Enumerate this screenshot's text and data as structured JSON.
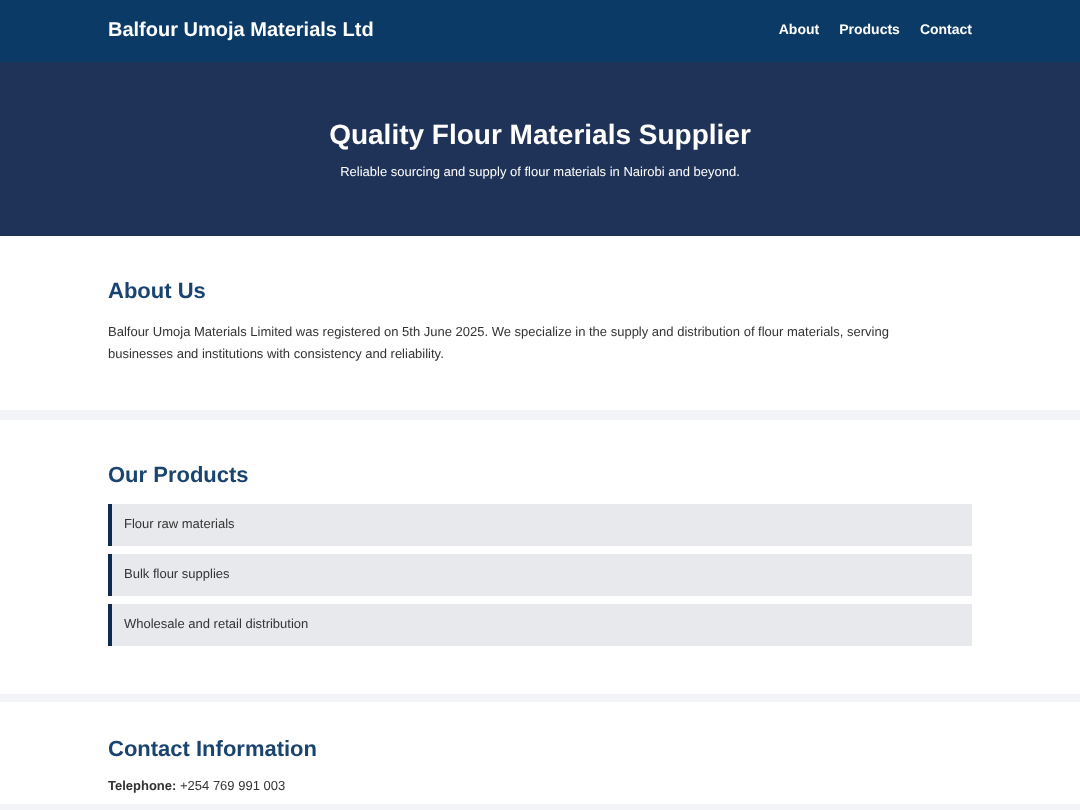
{
  "header": {
    "brand": "Balfour Umoja Materials Ltd",
    "nav": [
      "About",
      "Products",
      "Contact"
    ]
  },
  "hero": {
    "title": "Quality Flour Materials Supplier",
    "subtitle": "Reliable sourcing and supply of flour materials in Nairobi and beyond."
  },
  "about": {
    "heading": "About Us",
    "text": "Balfour Umoja Materials Limited was registered on 5th June 2025. We specialize in the supply and distribution of flour materials, serving businesses and institutions with consistency and reliability."
  },
  "products": {
    "heading": "Our Products",
    "items": [
      "Flour raw materials",
      "Bulk flour supplies",
      "Wholesale and retail distribution"
    ]
  },
  "contact": {
    "heading": "Contact Information",
    "lines": [
      "**Telephone:** +254 769 991 003"
    ]
  }
}
